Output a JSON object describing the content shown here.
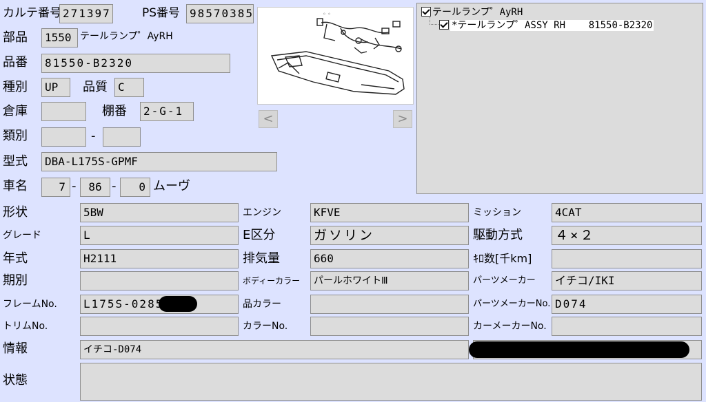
{
  "header": {
    "karte_label": "カルテ番号",
    "karte_value": "271397",
    "ps_label": "PS番号",
    "ps_value": "98570385"
  },
  "part": {
    "label": "部品",
    "code": "1550",
    "name": "テールランプ゜AyRH"
  },
  "hinban": {
    "label": "品番",
    "value": "81550-B2320"
  },
  "shubetsu": {
    "label": "種別",
    "value": "UP",
    "quality_label": "品質",
    "quality_value": "C"
  },
  "soko": {
    "label": "倉庫",
    "value": "",
    "tanaban_label": "棚番",
    "tanaban_value": "2-G-1"
  },
  "ruibetsu": {
    "label": "類別",
    "value1": "",
    "dash": "-",
    "value2": ""
  },
  "katashiki": {
    "label": "型式",
    "value": "DBA-L175S-GPMF"
  },
  "shamei": {
    "label": "車名",
    "v1": "7",
    "dash1": "-",
    "v2": "86",
    "dash2": "-",
    "v3": "0",
    "name": "ムーヴ"
  },
  "photo": {
    "prev_label": "<",
    "next_label": ">"
  },
  "tree": {
    "root": "テールランプ゜AyRH",
    "child": "*テールランプ゜ASSY RH    81550-B2320"
  },
  "grid": {
    "rows": [
      {
        "l1": "形状",
        "v1": "5BW",
        "l2": "エンジン",
        "v2": "KFVE",
        "l3": "ミッション",
        "v3": "4CAT"
      },
      {
        "l1": "グレード",
        "v1": "L",
        "l2": "E区分",
        "v2": "ガソリン",
        "l3": "駆動方式",
        "v3": "４×２"
      },
      {
        "l1": "年式",
        "v1": "H2111",
        "l2": "排気量",
        "v2": "660",
        "l3": "ｷﾛ数[千km]",
        "v3": ""
      },
      {
        "l1": "期別",
        "v1": "",
        "l2": "ボディーカラー",
        "v2": "パールホワイトⅢ",
        "l3": "パーツメーカー",
        "v3": "イチコ/IKI"
      },
      {
        "l1": "フレームNo.",
        "v1": "L175S-0285",
        "l2": "品カラー",
        "v2": "",
        "l3": "パーツメーカーNo.",
        "v3": "D074"
      },
      {
        "l1": "トリムNo.",
        "v1": "",
        "l2": "カラーNo.",
        "v2": "",
        "l3": "カーメーカーNo.",
        "v3": ""
      }
    ]
  },
  "info": {
    "label": "情報",
    "value": "イチコ-D074"
  },
  "status": {
    "label": "状態",
    "value": ""
  }
}
